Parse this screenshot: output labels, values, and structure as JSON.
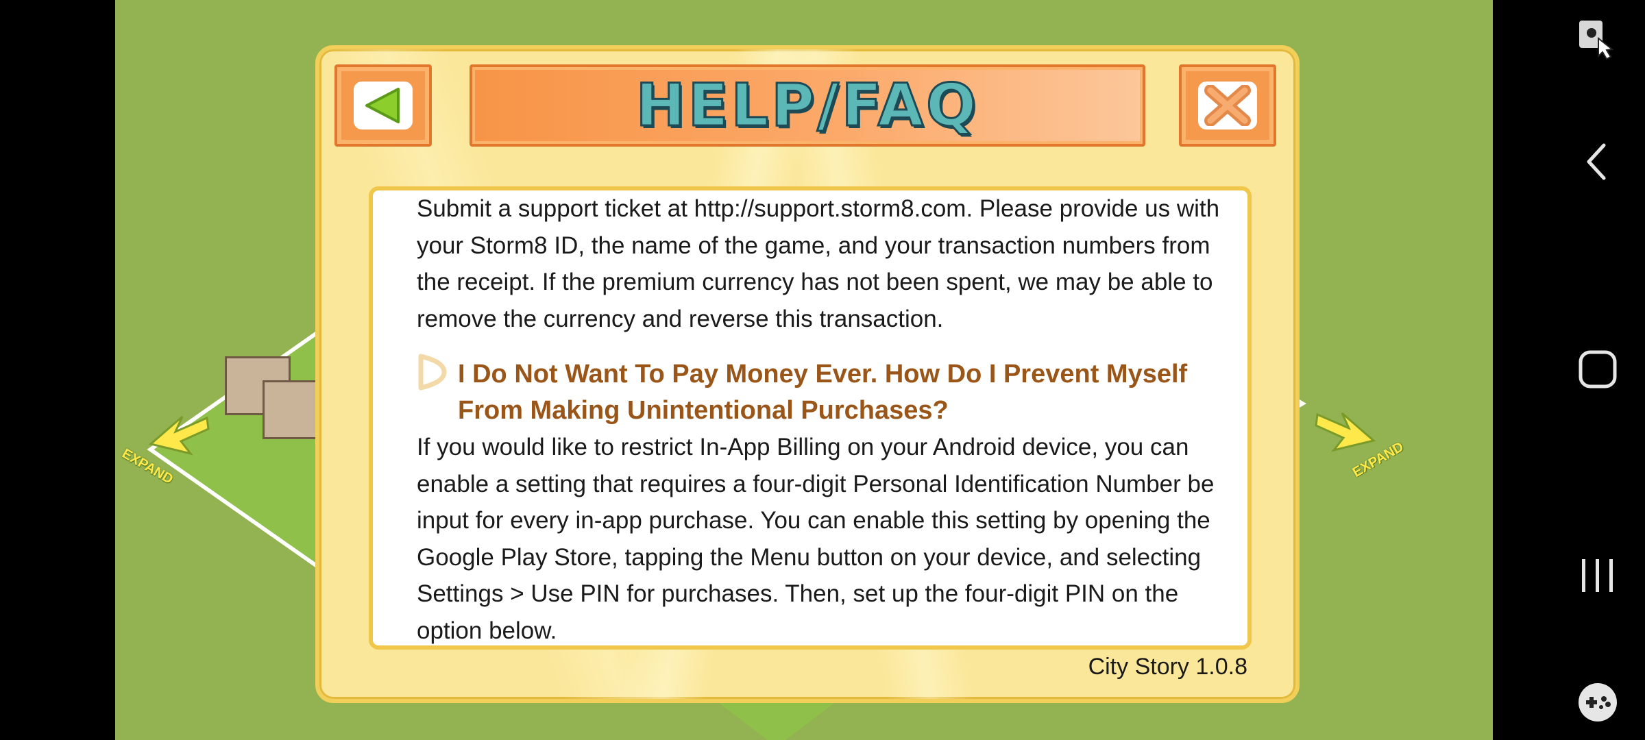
{
  "dialog": {
    "title": "HELP/FAQ",
    "back_icon": "green-left-triangle",
    "close_icon": "orange-x",
    "paragraph1": "Submit a support ticket at http://support.storm8.com. Please provide us with your Storm8 ID, the name of the game, and your transaction numbers from the receipt. If the premium currency has not been spent, we may be able to remove the currency and reverse this transaction.",
    "faq_question": "I Do Not Want To Pay Money Ever. How Do I Prevent Myself From Making Unintentional Purchases?",
    "faq_icon": "play-arrow-outline",
    "paragraph2": "If you would like to restrict In-App Billing on your Android device, you can enable a setting that requires a four-digit Personal Identification Number be input for every in-app purchase. You can enable this setting by opening the Google Play Store, tapping the Menu button on your device, and selecting Settings > Use PIN for purchases. Then, set up the four-digit PIN on the option below.",
    "version": "City Story 1.0.8"
  },
  "background": {
    "expand_label_left": "EXPAND",
    "expand_label_right": "EXPAND",
    "grass_color": "#93b352"
  },
  "system_nav": {
    "screenshot_icon": "screenshot-touch-icon",
    "back_icon": "chevron-left-icon",
    "home_icon": "rounded-square-icon",
    "recents_icon": "three-bars-icon",
    "game_icon": "gamepad-icon"
  }
}
